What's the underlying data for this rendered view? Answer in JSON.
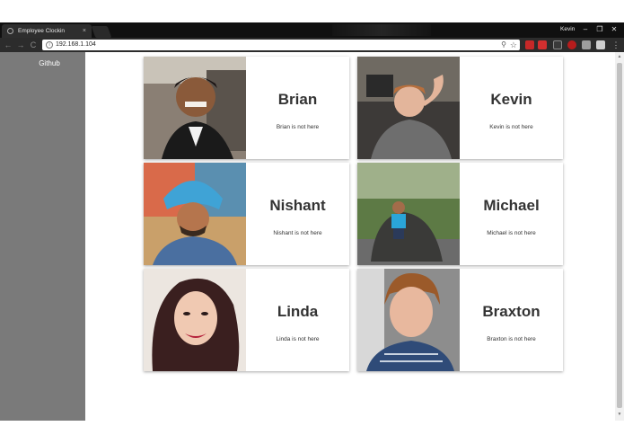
{
  "browser": {
    "tab_title": "Employee Clockin",
    "tab_close": "×",
    "profile_name": "Kevin",
    "url": "192.168.1.104",
    "window_controls": [
      "–",
      "❐",
      "✕"
    ]
  },
  "nav": {
    "back": "←",
    "forward": "→",
    "reload": "C"
  },
  "sidebar": {
    "links": [
      {
        "label": "Github"
      }
    ]
  },
  "employees": [
    {
      "name": "Brian",
      "status": "Brian is not here"
    },
    {
      "name": "Kevin",
      "status": "Kevin is not here"
    },
    {
      "name": "Nishant",
      "status": "Nishant is not here"
    },
    {
      "name": "Michael",
      "status": "Michael is not here"
    },
    {
      "name": "Linda",
      "status": "Linda is not here"
    },
    {
      "name": "Braxton",
      "status": "Braxton is not here"
    }
  ],
  "icons": {
    "info": "info-icon",
    "zoom": "zoom-icon",
    "bookmark": "star-icon",
    "menu": "kebab-menu-icon"
  },
  "colors": {
    "sidebar": "#7a7a7a",
    "chrome_dark": "#101010",
    "toolbar": "#2c2c2c",
    "card_text": "#333333"
  }
}
